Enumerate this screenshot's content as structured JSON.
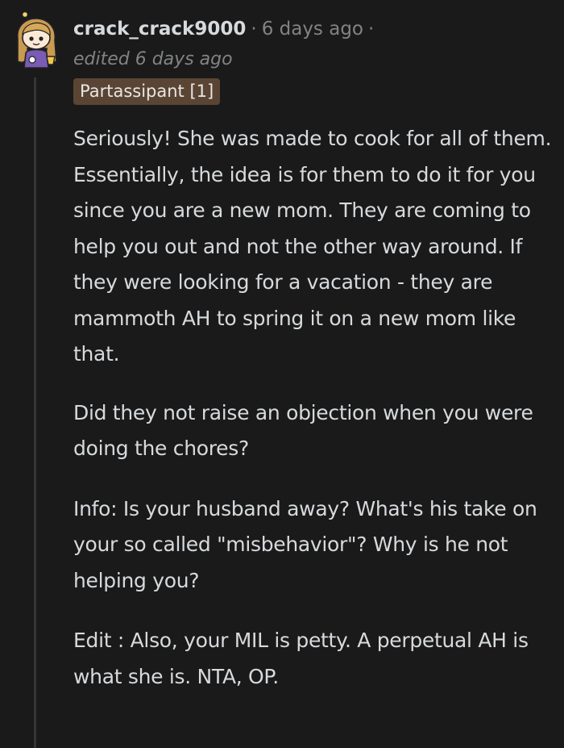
{
  "comment": {
    "username": "crack_crack9000",
    "separator": "·",
    "timeago": "6 days ago",
    "edited": "edited 6 days ago",
    "flair": "Partassipant [1]",
    "avatar_icon": "snoo-avatar-icon",
    "paragraphs": [
      "Seriously! She was made to cook for all of them. Essentially, the idea is for them to do it for you since you are a new mom. They are coming to help you out and not the other way around. If they were looking for a vacation - they are mammoth AH to spring it on a new mom like that.",
      "Did they not raise an objection when you were doing the chores?",
      "Info: Is your husband away? What's his take on your so called \"misbehavior\"? Why is he not helping you?",
      "Edit : Also, your MIL is petty. A perpetual AH is what she is. NTA, OP."
    ]
  },
  "colors": {
    "background": "#1a1a1b",
    "text": "#d7dadc",
    "meta": "#818384",
    "flair_bg": "#5a4535",
    "thread_line": "#343536"
  }
}
